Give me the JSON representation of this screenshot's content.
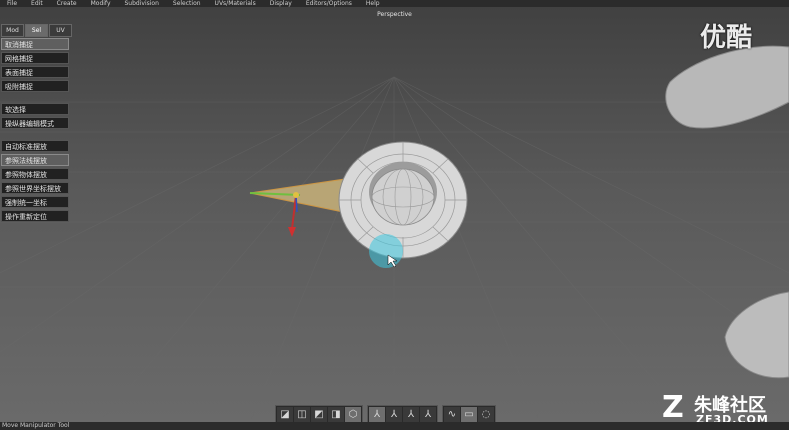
{
  "menubar": {
    "items": [
      "File",
      "Edit",
      "Create",
      "Modify",
      "Subdivision",
      "Selection",
      "UVs/Materials",
      "Display",
      "Editors/Options",
      "Help"
    ]
  },
  "viewport": {
    "label": "Perspective"
  },
  "tabs": [
    {
      "label": "Mod",
      "active": false
    },
    {
      "label": "Sel",
      "active": true
    },
    {
      "label": "UV",
      "active": false
    }
  ],
  "snap_buttons": {
    "group1": [
      "取消捕捉",
      "网格捕捉",
      "表面捕捉",
      "吸附捕捉"
    ],
    "group2": [
      "软选择",
      "操纵器编辑模式"
    ],
    "group3": [
      "自动标准摆放",
      "参照法线摆放",
      "参照物体摆放",
      "参照世界坐标摆放",
      "强制统一坐标",
      "操作重新定位"
    ]
  },
  "toolbar": {
    "shading_icons": [
      "shaded-cube-icon",
      "wire-cube-icon",
      "flat-cube-icon",
      "smooth-cube-icon",
      "hex-icon"
    ],
    "axis_icons": [
      "axis-icon-1",
      "axis-icon-2",
      "axis-icon-3",
      "axis-icon-4"
    ],
    "select_icons": [
      "lasso-icon",
      "marquee-icon",
      "paint-select-icon"
    ]
  },
  "status": {
    "text": "Move Manipulator Tool"
  },
  "watermark": {
    "top": "优酷",
    "site_name": "朱峰社区",
    "site_url": "ZF3D.COM",
    "logo_glyph": "Z"
  },
  "colors": {
    "bg_dark": "#2b2b2b",
    "button_bg": "#212121",
    "highlight": "#3ec8e0"
  }
}
